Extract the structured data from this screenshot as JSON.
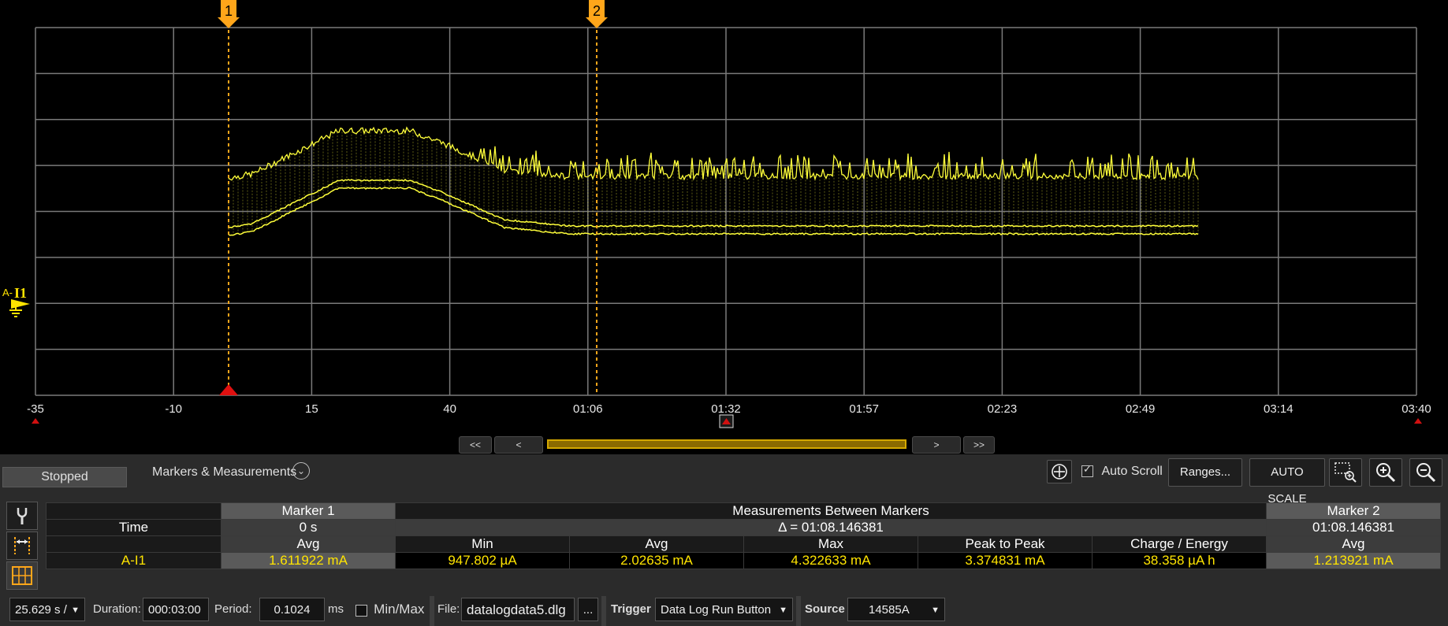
{
  "plot": {
    "x_ticks": [
      "-35",
      "-10",
      "15",
      "40",
      "01:06",
      "01:32",
      "01:57",
      "02:23",
      "02:49",
      "03:14",
      "03:40"
    ],
    "marker1_label": "1",
    "marker2_label": "2",
    "channel_prefix": "A-",
    "channel_name": "I1",
    "trace_color": "#ffff3a",
    "marker_color": "#ffa61a",
    "grid_color": "#7a7a7a"
  },
  "nav": {
    "first": "<<",
    "prev": "<",
    "next": ">",
    "last": ">>"
  },
  "toolbar": {
    "status": "Stopped",
    "markers_measurements": "Markers & Measurements",
    "auto_scroll": "Auto Scroll",
    "auto_scroll_checked": true,
    "ranges": "Ranges...",
    "auto_scale": "AUTO SCALE"
  },
  "table": {
    "marker1": {
      "title": "Marker 1",
      "time": "0 s",
      "col": "Avg",
      "value": "1.611922 mA"
    },
    "between": {
      "title": "Measurements Between Markers",
      "delta": "Δ = 01:08.146381",
      "cols": [
        "Min",
        "Avg",
        "Max",
        "Peak to Peak",
        "Charge / Energy"
      ],
      "values": [
        "947.802 µA",
        "2.02635 mA",
        "4.322633 mA",
        "3.374831 mA",
        "38.358 µA h"
      ]
    },
    "marker2": {
      "title": "Marker 2",
      "time": "01:08.146381",
      "col": "Avg",
      "value": "1.213921 mA"
    },
    "row_time": "Time",
    "row_channel": "A-I1"
  },
  "bottom": {
    "timebase": "25.629 s /",
    "duration_label": "Duration:",
    "duration": "000:03:00",
    "period_label": "Period:",
    "period": "0.1024",
    "period_unit": "ms",
    "minmax": "Min/Max",
    "file_label": "File:",
    "file": "datalogdata5.dlg",
    "browse": "...",
    "trigger_label": "Trigger",
    "trigger": "Data Log Run Button",
    "source_label": "Source",
    "source": "14585A"
  }
}
